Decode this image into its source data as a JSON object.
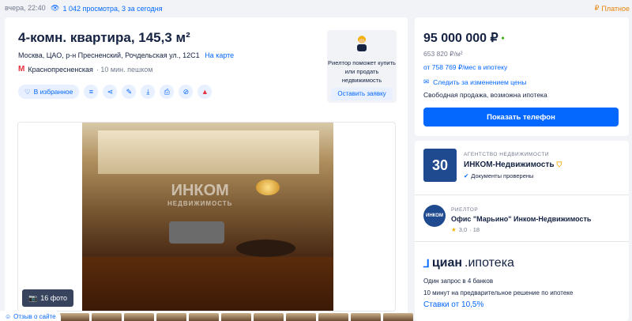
{
  "topbar": {
    "time": "вчера, 22:40",
    "views": "1 042 просмотра, 3 за сегодня",
    "paid": "Платное"
  },
  "listing": {
    "title": "4-комн. квартира, 145,3 м²",
    "address": "Москва, ЦАО, р-н Пресненский, Рочдельская ул., 12С1",
    "map_link": "На карте",
    "metro_station": "Краснопресненская",
    "metro_walk": "· 10 мин. пешком",
    "favorite_label": "В избранное",
    "photo_count": "16 фото",
    "watermark": "ИНКОМ",
    "watermark_sub": "НЕДВИЖИМОСТЬ"
  },
  "realtor_promo": {
    "text": "Риелтор поможет купить или продать недвижимость",
    "button": "Оставить заявку"
  },
  "price": {
    "value": "95 000 000 ₽",
    "per_m2": "653 820 ₽/м²",
    "mortgage": "от 758 769 ₽/мес в ипотеку",
    "follow": "Следить за изменением цены",
    "sale_type": "Свободная продажа, возможна ипотека",
    "show_phone": "Показать телефон"
  },
  "agency": {
    "logo_text": "30",
    "type": "АГЕНТСТВО НЕДВИЖИМОСТИ",
    "name": "ИНКОМ-Недвижимость",
    "docs": "Документы проверены"
  },
  "office": {
    "logo_text": "ИНКОМ",
    "type": "РИЕЛТОР",
    "name": "Офис \"Марьино\" Инком-Недвижимость",
    "rating": "3,0",
    "reviews": "· 18"
  },
  "cian": {
    "brand": "циан",
    "product": ".ипотека",
    "line1": "Один запрос в 4 банков",
    "line2": "10 минут на предварительное решение по ипотеке",
    "rate": "Ставки от 10,5%"
  },
  "feedback": "Отзыв о сайте",
  "colors": {
    "accent": "#0468ff",
    "text": "#152242",
    "muted": "#737a8e",
    "background": "#f1f3f6",
    "paid": "#e8830c",
    "metro": "#e8313c",
    "price_down": "#34ac0a"
  }
}
